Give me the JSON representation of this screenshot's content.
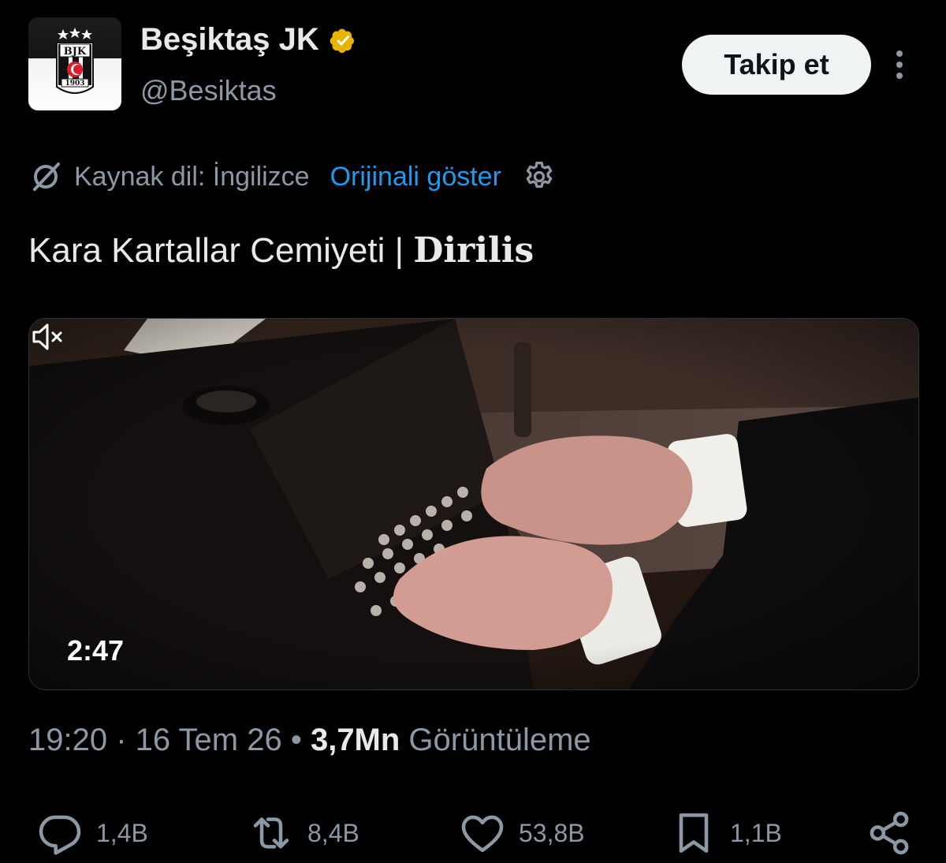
{
  "header": {
    "display_name": "Beşiktaş JK",
    "handle": "@Besiktas",
    "follow_label": "Takip et",
    "logo_text": "BJK",
    "logo_year": "1903"
  },
  "translation": {
    "source_label": "Kaynak dil: İngilizce",
    "show_original_label": "Orijinali göster"
  },
  "tweet": {
    "text_main": "Kara Kartallar Cemiyeti | ",
    "text_emphasis": "Dirilis"
  },
  "video": {
    "duration": "2:47"
  },
  "meta": {
    "time": "19:20",
    "separator": " · ",
    "date": "16 Tem 26",
    "separator2": " • ",
    "views_count": "3,7Mn",
    "views_label": " Görüntüleme"
  },
  "actions": {
    "replies": "1,4B",
    "reposts": "8,4B",
    "likes": "53,8B",
    "bookmarks": "1,1B"
  },
  "colors": {
    "background": "#000000",
    "primary_text": "#e7e9ea",
    "secondary_text": "#8b98a5",
    "link": "#1d9bf0",
    "verified_gold": "#e8b400"
  }
}
